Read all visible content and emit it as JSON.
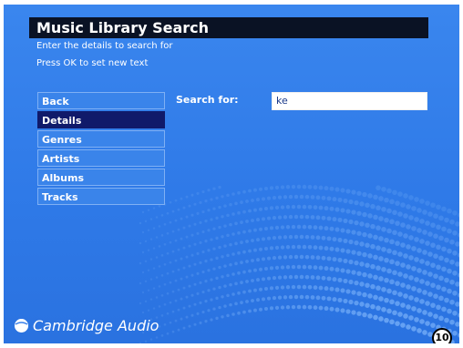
{
  "header": {
    "title": "Music Library Search",
    "subtitle_line1": "Enter the details to search for",
    "subtitle_line2": "Press OK to set new text"
  },
  "menu": {
    "items": [
      {
        "label": "Back",
        "selected": false
      },
      {
        "label": "Details",
        "selected": true
      },
      {
        "label": "Genres",
        "selected": false
      },
      {
        "label": "Artists",
        "selected": false
      },
      {
        "label": "Albums",
        "selected": false
      },
      {
        "label": "Tracks",
        "selected": false
      }
    ]
  },
  "search": {
    "label": "Search for:",
    "value": "ke"
  },
  "brand": {
    "name": "Cambridge Audio",
    "logo_icon": "cambridge-audio-logo-icon"
  },
  "badge": {
    "number": "10"
  },
  "colors": {
    "background": "#3a86ee",
    "header_bar": "#0a1224",
    "selected_item": "#101a6a"
  }
}
